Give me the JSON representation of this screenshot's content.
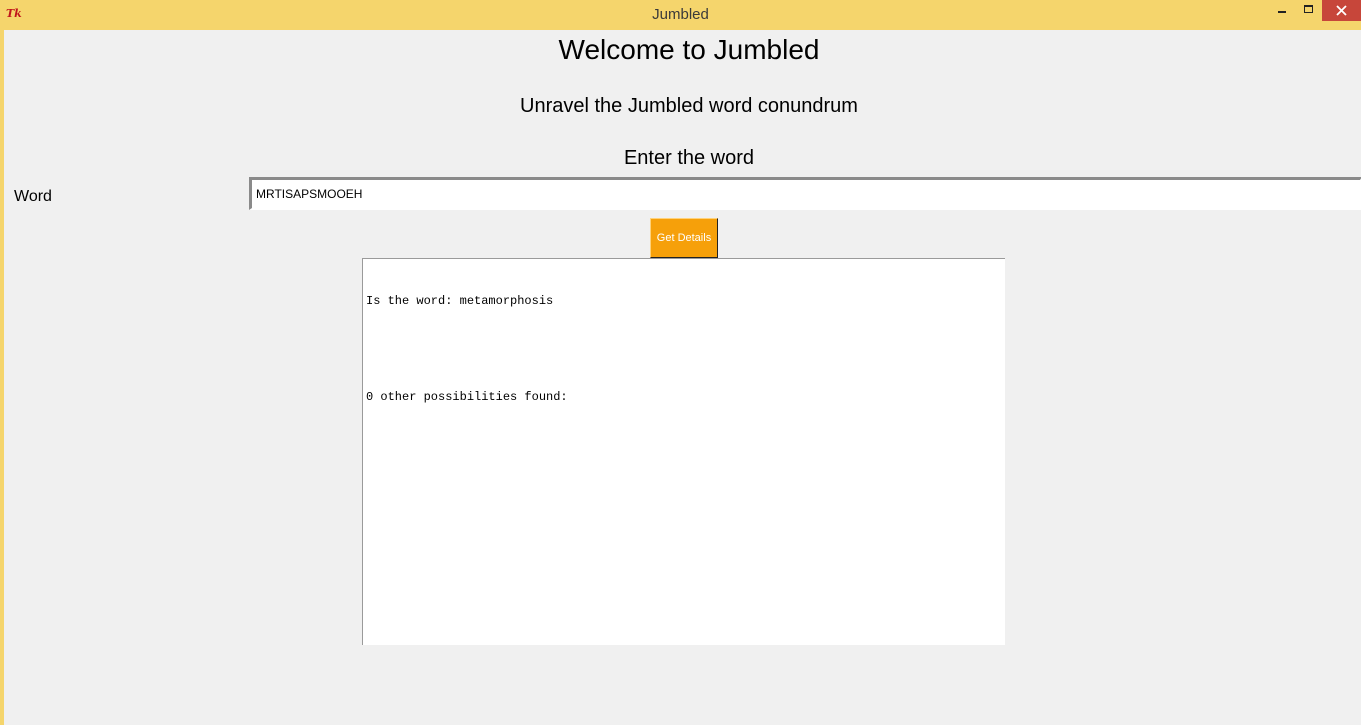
{
  "window": {
    "title": "Jumbled",
    "app_icon": "tk-feather-icon",
    "app_icon_text": "Tk",
    "controls": [
      "minimize-icon",
      "maximize-icon",
      "close-icon"
    ]
  },
  "main": {
    "welcome_title": "Welcome to Jumbled",
    "subtitle": "Unravel the Jumbled word conundrum",
    "instruction": "Enter the word"
  },
  "form": {
    "word_label": "Word",
    "word_value": "MRTISAPSMOOEH",
    "button_label": "Get Details"
  },
  "results": {
    "lines": [
      "Is the word: metamorphosis",
      "",
      "0 other possibilities found:"
    ]
  },
  "colors": {
    "titlebar": "#f5d56c",
    "close_button": "#c7463a",
    "button_bg": "#f6a00a",
    "client_bg": "#f0f0f0"
  }
}
